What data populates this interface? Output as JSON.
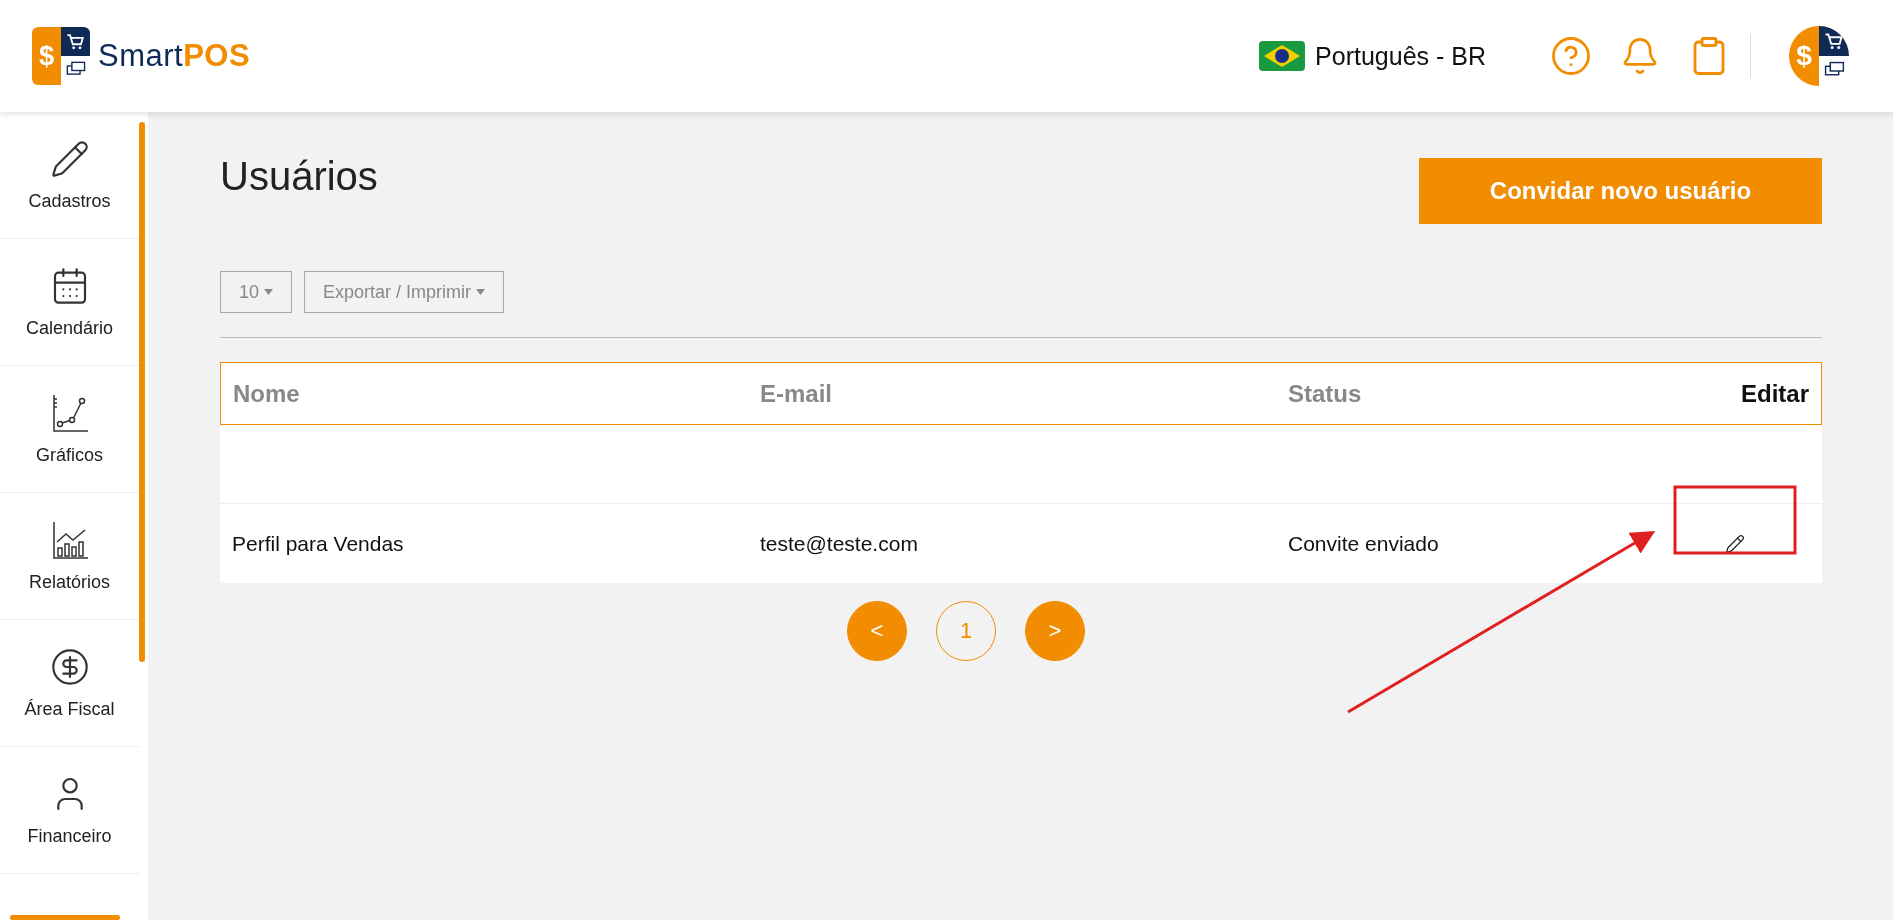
{
  "header": {
    "logo": {
      "symbol": "$",
      "part_1": "Smart",
      "part_2": "POS"
    },
    "language": "Português - BR",
    "avatar": {
      "symbol": "$"
    }
  },
  "sidebar": {
    "items": [
      {
        "label": "Cadastros"
      },
      {
        "label": "Calendário"
      },
      {
        "label": "Gráficos"
      },
      {
        "label": "Relatórios"
      },
      {
        "label": "Área Fiscal"
      },
      {
        "label": "Financeiro"
      }
    ]
  },
  "page": {
    "title": "Usuários",
    "invite_button": "Convidar novo usuário",
    "toolbar": {
      "page_size": "10",
      "export": "Exportar / Imprimir"
    },
    "table": {
      "columns": [
        "Nome",
        "E-mail",
        "Status",
        "Editar"
      ],
      "rows": [
        {
          "name": "Perfil para Vendas",
          "email": "teste@teste.com",
          "status": "Convite enviado"
        }
      ]
    },
    "pagination": {
      "prev": "<",
      "next": ">",
      "pages": [
        {
          "label": "1",
          "selected": true
        }
      ]
    }
  }
}
